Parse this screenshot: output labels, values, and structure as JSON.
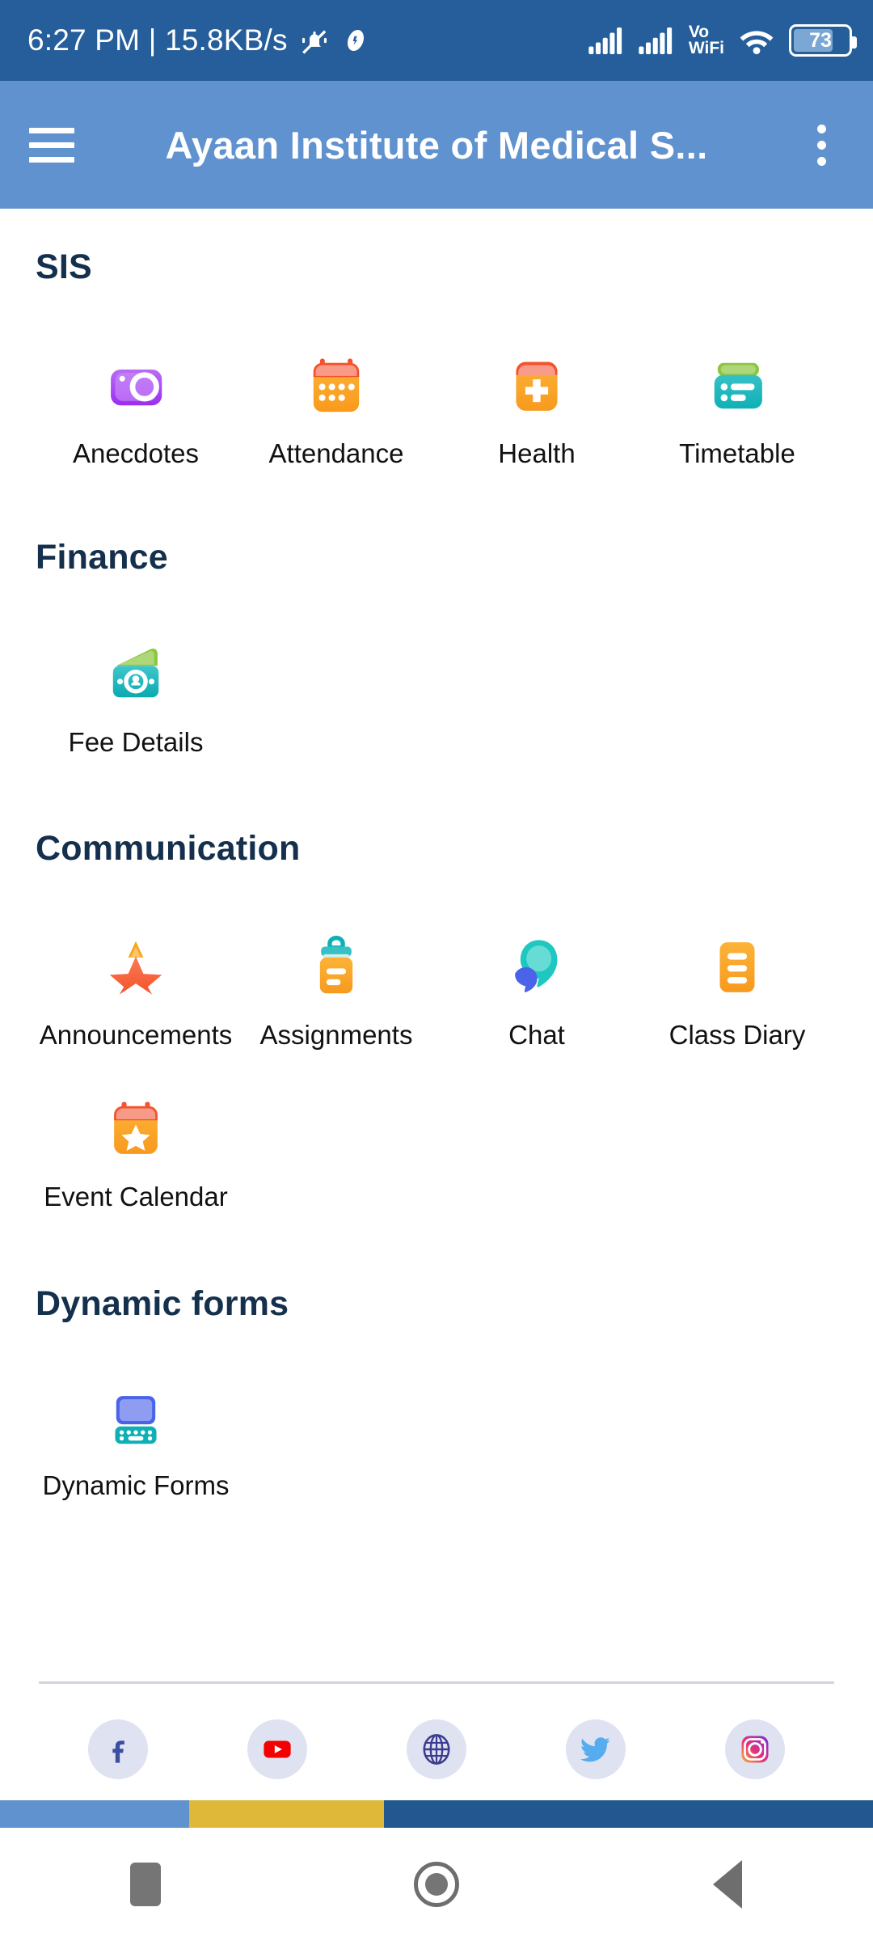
{
  "status_bar": {
    "time": "6:27 PM",
    "separator": "|",
    "network_speed": "15.8KB/s",
    "mute_icon": "bell-muted-icon",
    "app_icon": "app-badge-icon",
    "signal_1_icon": "signal-bars-icon",
    "signal_2_icon": "signal-bars-icon",
    "volte_line1": "Vo",
    "volte_line2": "WiFi",
    "wifi_icon": "wifi-icon",
    "battery_percent": "73",
    "battery_level": 73
  },
  "app_bar": {
    "menu_icon": "hamburger-menu-icon",
    "title": "Ayaan Institute of Medical S...",
    "overflow_icon": "more-vertical-icon",
    "background_color": "#5f92cf"
  },
  "theme": {
    "status_bar_color": "#255e9a",
    "heading_color": "#14304d",
    "label_color": "#111111",
    "divider_color": "#d2d4dc"
  },
  "sections": [
    {
      "title": "SIS",
      "items": [
        {
          "label": "Anecdotes",
          "icon": "camera-icon"
        },
        {
          "label": "Attendance",
          "icon": "calendar-dots-icon"
        },
        {
          "label": "Health",
          "icon": "medical-cross-icon"
        },
        {
          "label": "Timetable",
          "icon": "timetable-list-icon"
        }
      ]
    },
    {
      "title": "Finance",
      "items": [
        {
          "label": "Fee Details",
          "icon": "money-wallet-icon"
        }
      ]
    },
    {
      "title": "Communication",
      "items": [
        {
          "label": "Announcements",
          "icon": "star-announcement-icon"
        },
        {
          "label": "Assignments",
          "icon": "clipboard-icon"
        },
        {
          "label": "Chat",
          "icon": "chat-bubbles-icon"
        },
        {
          "label": "Class Diary",
          "icon": "document-lines-icon"
        },
        {
          "label": "Event Calendar",
          "icon": "calendar-star-icon"
        }
      ]
    },
    {
      "title": "Dynamic forms",
      "items": [
        {
          "label": "Dynamic Forms",
          "icon": "laptop-keyboard-icon"
        }
      ]
    }
  ],
  "social_links": [
    {
      "name": "facebook",
      "icon": "facebook-icon"
    },
    {
      "name": "youtube",
      "icon": "youtube-icon"
    },
    {
      "name": "website",
      "icon": "globe-icon"
    },
    {
      "name": "twitter",
      "icon": "twitter-icon"
    },
    {
      "name": "instagram",
      "icon": "instagram-icon"
    }
  ],
  "color_strip": [
    "#5f92cf",
    "#e0b839",
    "#22578f"
  ],
  "nav_bar": {
    "recents_icon": "square-recents-icon",
    "home_icon": "circle-home-icon",
    "back_icon": "triangle-back-icon"
  }
}
